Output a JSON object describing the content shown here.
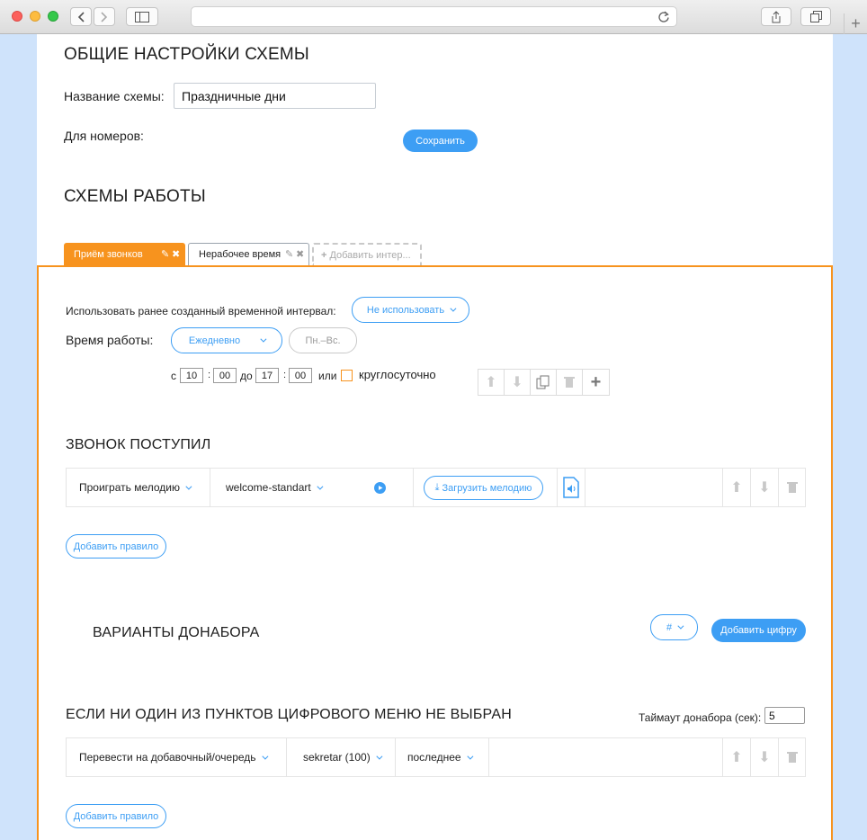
{
  "general": {
    "title": "ОБЩИЕ НАСТРОЙКИ СХЕМЫ",
    "name_label": "Название схемы:",
    "name_value": "Праздничные дни",
    "numbers_label": "Для номеров:",
    "save_label": "Сохранить"
  },
  "schemes": {
    "title": "СХЕМЫ РАБОТЫ",
    "tabs": [
      {
        "label": "Приём звонков",
        "active": true
      },
      {
        "label": "Нерабочее время",
        "active": false
      },
      {
        "label": "Добавить интер...",
        "active": false
      }
    ]
  },
  "interval": {
    "use_label": "Использовать ранее созданный временной интервал:",
    "use_value": "Не использовать",
    "work_time_label": "Время работы:",
    "frequency_value": "Ежедневно",
    "days_value": "Пн.–Вс.",
    "from_label": "с",
    "from_h": "10",
    "from_m": "00",
    "to_label": "до",
    "to_h": "17",
    "to_m": "00",
    "or_label": "или",
    "allday_label": "круглосуточно"
  },
  "incoming": {
    "title": "ЗВОНОК ПОСТУПИЛ",
    "action": "Проиграть мелодию",
    "melody": "welcome-standart",
    "upload_label": "Загрузить мелодию",
    "add_rule_label": "Добавить правило"
  },
  "dial": {
    "title": "ВАРИАНТЫ ДОНАБОРА",
    "key_value": "#",
    "add_digit_label": "Добавить цифру"
  },
  "fallback": {
    "title": "ЕСЛИ НИ ОДИН ИЗ ПУНКТОВ ЦИФРОВОГО МЕНЮ НЕ ВЫБРАН",
    "timeout_label": "Таймаут донабора (сек):",
    "timeout_value": "5",
    "action": "Перевести на добавочный/очередь",
    "target": "sekretar (100)",
    "order": "последнее",
    "add_rule_label": "Добавить правило"
  },
  "colors": {
    "accent": "#3d9ef4",
    "tab_active": "#f7931e"
  }
}
